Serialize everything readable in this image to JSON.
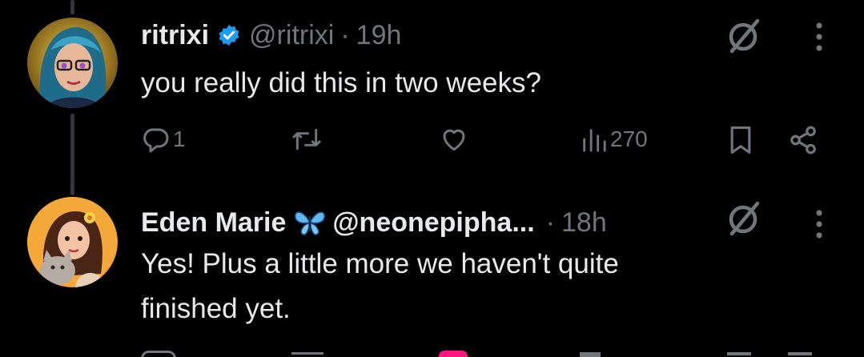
{
  "colors": {
    "background": "#000000",
    "text": "#e7e9ea",
    "muted": "#71767b",
    "verified": "#1d9bf0",
    "thread_line": "#333639"
  },
  "tweets": [
    {
      "display_name": "ritrixi",
      "handle": "@ritrixi",
      "separator": "·",
      "time": "19h",
      "badge_icon": "verified-badge-icon",
      "avatar": "avatar-woman-blue-hair-glasses",
      "text": "you really did this in two weeks?",
      "actions": {
        "reply_count": "1",
        "retweet_count": "",
        "like_count": "",
        "views_count": "270"
      }
    },
    {
      "display_name": "Eden Marie",
      "name_emoji": "🦋",
      "handle": "@neonepipha...",
      "separator": "·",
      "time": "18h",
      "avatar": "avatar-woman-with-cat",
      "text_line1": "Yes! Plus a little more we haven't quite",
      "text_line2": "finished yet."
    }
  ]
}
